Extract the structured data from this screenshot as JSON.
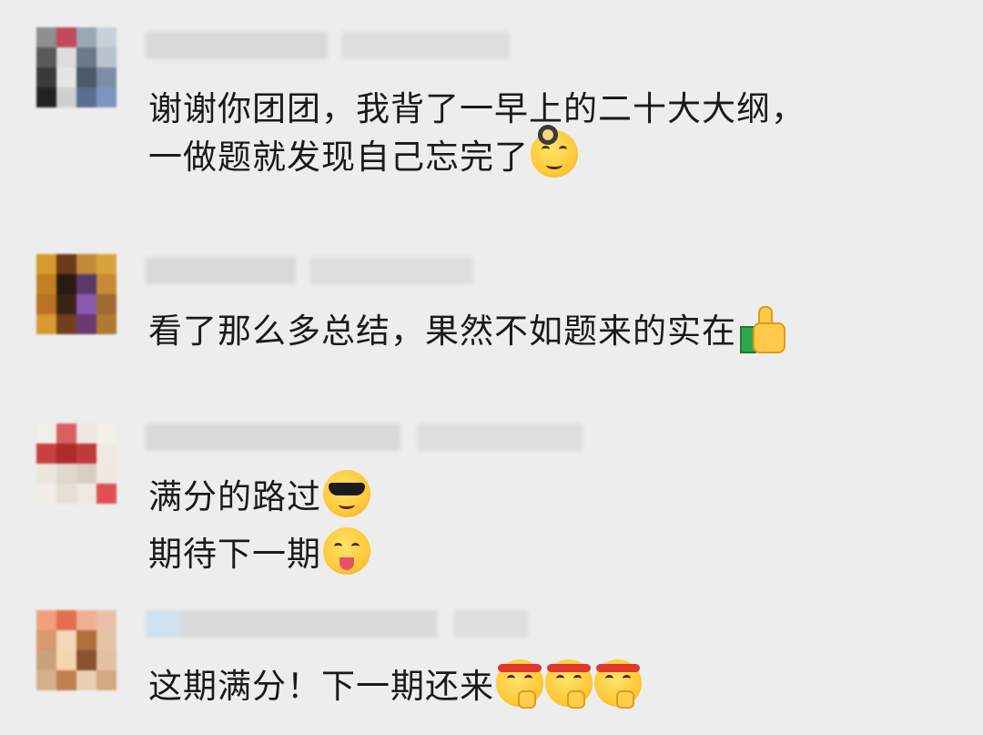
{
  "comments": [
    {
      "lines": [
        "谢谢你团团，我背了一早上的二十大大纲，",
        "一做题就发现自己忘完了"
      ],
      "emojis": [
        "pan-face-emoji"
      ]
    },
    {
      "lines": [
        "看了那么多总结，果然不如题来的实在"
      ],
      "emojis": [
        "thumbs-up-emoji"
      ]
    },
    {
      "lines": [
        "满分的路过",
        "期待下一期"
      ],
      "emojis": [
        "sunglasses-face-emoji",
        "winking-tongue-face-emoji"
      ]
    },
    {
      "lines": [
        "这期满分！下一期还来"
      ],
      "emojis": [
        "headband-face-emoji",
        "headband-face-emoji",
        "headband-face-emoji"
      ]
    }
  ],
  "colors": {
    "background": "#ededed",
    "text": "#1a1a1a",
    "blurred_name": "#d9d9d9"
  }
}
